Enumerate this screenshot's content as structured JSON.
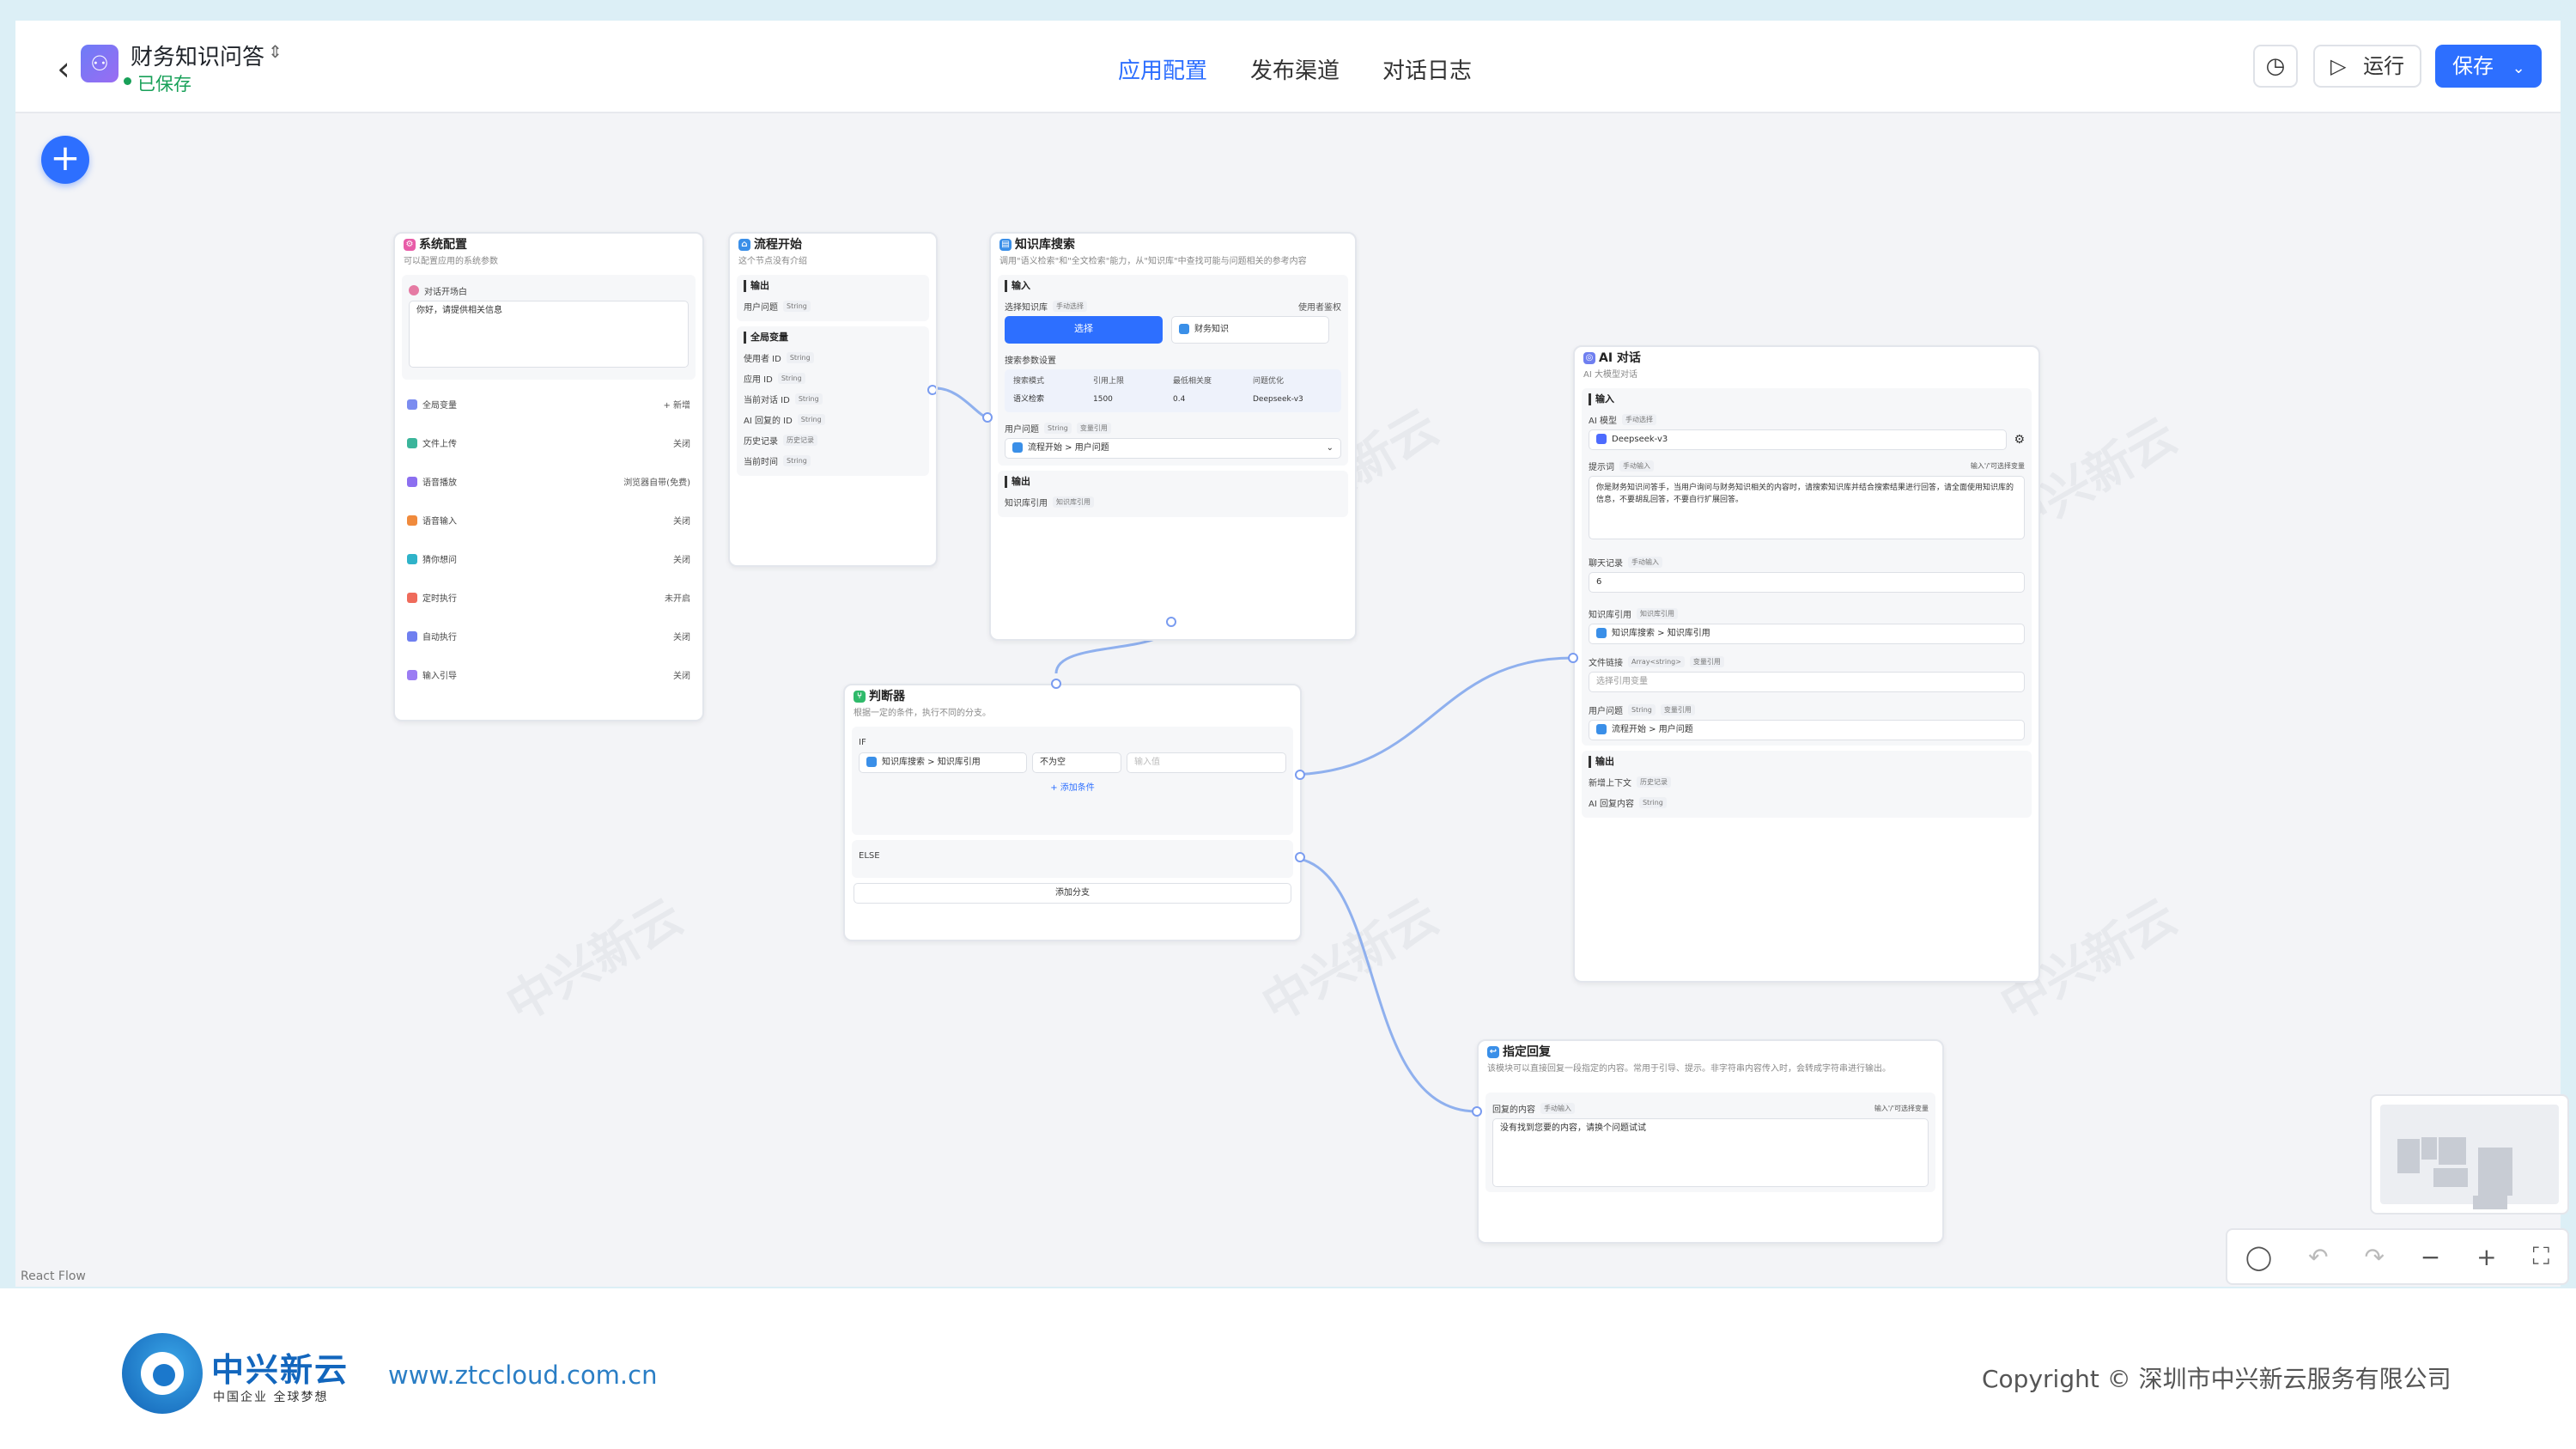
{
  "header": {
    "title": "财务知识问答",
    "status": "已保存",
    "tabs": [
      "应用配置",
      "发布渠道",
      "对话日志"
    ],
    "active_tab": "应用配置",
    "run_label": "运行",
    "save_label": "保存"
  },
  "canvas": {
    "react_flow_label": "React Flow"
  },
  "nodes": {
    "system": {
      "title": "系统配置",
      "subtitle": "可以配置应用的系统参数",
      "greeting_label": "对话开场白",
      "greeting_text": "你好，请提供相关信息",
      "items": [
        {
          "label": "全局变量",
          "value": "+ 新增"
        },
        {
          "label": "文件上传",
          "value": "关闭"
        },
        {
          "label": "语音播放",
          "value": "浏览器自带(免费)"
        },
        {
          "label": "语音输入",
          "value": "关闭"
        },
        {
          "label": "猜你想问",
          "value": "关闭"
        },
        {
          "label": "定时执行",
          "value": "未开启"
        },
        {
          "label": "自动执行",
          "value": "关闭"
        },
        {
          "label": "输入引导",
          "value": "关闭"
        }
      ]
    },
    "start": {
      "title": "流程开始",
      "subtitle": "这个节点没有介绍",
      "output_label": "输出",
      "output_item": "用户问题",
      "global_label": "全局变量",
      "globals": [
        "使用者 ID",
        "应用 ID",
        "当前对话 ID",
        "AI 回复的 ID",
        "历史记录",
        "当前时间"
      ],
      "type_tag": "String",
      "history_tag": "历史记录"
    },
    "kb": {
      "title": "知识库搜索",
      "subtitle": "调用\"语义检索\"和\"全文检索\"能力，从\"知识库\"中查找可能与问题相关的参考内容",
      "input_label": "输入",
      "select_kb_label": "选择知识库",
      "manual_label": "手动选择",
      "use_access": "使用者鉴权",
      "select_btn": "选择",
      "kb_name": "财务知识",
      "search_params_label": "搜索参数设置",
      "table_headers": [
        "搜索模式",
        "引用上限",
        "最低相关度",
        "问题优化"
      ],
      "table_row": [
        "语义检索",
        "1500",
        "0.4",
        "Deepseek-v3"
      ],
      "question_label": "用户问题",
      "var_ref": "变量引用",
      "question_value": "流程开始 > 用户问题",
      "output_label": "输出",
      "output_item": "知识库引用",
      "output_tag": "知识库引用"
    },
    "judge": {
      "title": "判断器",
      "subtitle": "根据一定的条件，执行不同的分支。",
      "if_label": "IF",
      "if_source": "知识库搜索 > 知识库引用",
      "if_op": "不为空",
      "if_value_placeholder": "输入值",
      "add_condition": "+ 添加条件",
      "else_label": "ELSE",
      "add_branch": "添加分支"
    },
    "ai": {
      "title": "AI 对话",
      "subtitle": "AI 大模型对话",
      "input_label": "输入",
      "model_label": "AI 模型",
      "manual_select": "手动选择",
      "model_value": "Deepseek-v3",
      "prompt_label": "提示词",
      "manual_input": "手动输入",
      "insert_hint": "输入'/'可选择变量",
      "prompt_text": "你是财务知识问答手，当用户询问与财务知识相关的内容时，请搜索知识库并结合搜索结果进行回答，请全面使用知识库的信息，不要胡乱回答，不要自行扩展回答。",
      "history_label": "聊天记录",
      "history_value": "6",
      "kb_ref_label": "知识库引用",
      "kb_ref_tag": "知识库引用",
      "kb_ref_value": "知识库搜索 > 知识库引用",
      "file_link_label": "文件链接",
      "file_link_tag": "Array<string>",
      "file_link_var": "变量引用",
      "file_link_placeholder": "选择引用变量",
      "question_label": "用户问题",
      "question_value": "流程开始 > 用户问题",
      "output_label": "输出",
      "out_items": [
        {
          "label": "新增上下文",
          "tag": "历史记录"
        },
        {
          "label": "AI 回复内容",
          "tag": "String"
        }
      ]
    },
    "reply": {
      "title": "指定回复",
      "subtitle": "该模块可以直接回复一段指定的内容。常用于引导、提示。非字符串内容传入时，会转成字符串进行输出。",
      "content_label": "回复的内容",
      "manual_input": "手动输入",
      "insert_hint": "输入'/'可选择变量",
      "content_text": "没有找到您要的内容，请换个问题试试"
    }
  },
  "footer": {
    "brand_cn": "中兴新云",
    "brand_slogan": "中国企业 全球梦想",
    "website": "www.ztccloud.com.cn",
    "copyright": "Copyright © 深圳市中兴新云服务有限公司"
  },
  "colors": {
    "accent": "#2d6fff",
    "saved": "#18a058",
    "brand": "#1266bd"
  }
}
